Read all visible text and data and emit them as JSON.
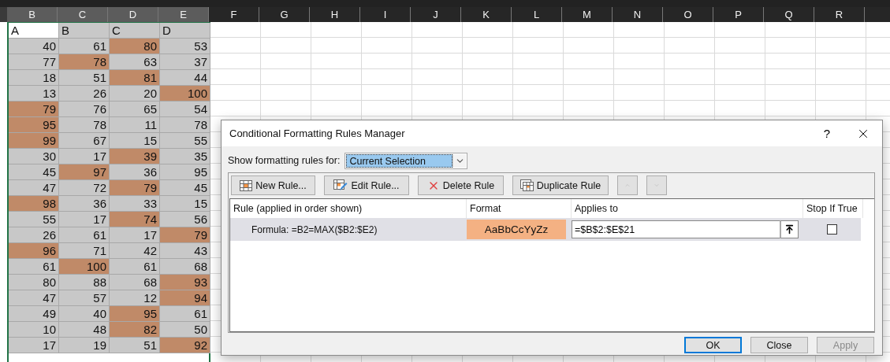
{
  "sheet": {
    "column_headers": [
      {
        "label": "B",
        "selected": true
      },
      {
        "label": "C",
        "selected": true
      },
      {
        "label": "D",
        "selected": true
      },
      {
        "label": "E",
        "selected": true
      },
      {
        "label": "F",
        "selected": false
      },
      {
        "label": "G",
        "selected": false
      },
      {
        "label": "H",
        "selected": false
      },
      {
        "label": "I",
        "selected": false
      },
      {
        "label": "J",
        "selected": false
      },
      {
        "label": "K",
        "selected": false
      },
      {
        "label": "L",
        "selected": false
      },
      {
        "label": "M",
        "selected": false
      },
      {
        "label": "N",
        "selected": false
      },
      {
        "label": "O",
        "selected": false
      },
      {
        "label": "P",
        "selected": false
      },
      {
        "label": "Q",
        "selected": false
      },
      {
        "label": "R",
        "selected": false
      }
    ],
    "header_row": [
      {
        "text": "A",
        "active": true
      },
      {
        "text": "B",
        "active": false
      },
      {
        "text": "C",
        "active": false
      },
      {
        "text": "D",
        "active": false
      }
    ],
    "rows": [
      [
        {
          "text": "40",
          "highlighted": false
        },
        {
          "text": "61",
          "highlighted": false
        },
        {
          "text": "80",
          "highlighted": true
        },
        {
          "text": "53",
          "highlighted": false
        }
      ],
      [
        {
          "text": "77",
          "highlighted": false
        },
        {
          "text": "78",
          "highlighted": true
        },
        {
          "text": "63",
          "highlighted": false
        },
        {
          "text": "37",
          "highlighted": false
        }
      ],
      [
        {
          "text": "18",
          "highlighted": false
        },
        {
          "text": "51",
          "highlighted": false
        },
        {
          "text": "81",
          "highlighted": true
        },
        {
          "text": "44",
          "highlighted": false
        }
      ],
      [
        {
          "text": "13",
          "highlighted": false
        },
        {
          "text": "26",
          "highlighted": false
        },
        {
          "text": "20",
          "highlighted": false
        },
        {
          "text": "100",
          "highlighted": true
        }
      ],
      [
        {
          "text": "79",
          "highlighted": true
        },
        {
          "text": "76",
          "highlighted": false
        },
        {
          "text": "65",
          "highlighted": false
        },
        {
          "text": "54",
          "highlighted": false
        }
      ],
      [
        {
          "text": "95",
          "highlighted": true
        },
        {
          "text": "78",
          "highlighted": false
        },
        {
          "text": "11",
          "highlighted": false
        },
        {
          "text": "78",
          "highlighted": false
        }
      ],
      [
        {
          "text": "99",
          "highlighted": true
        },
        {
          "text": "67",
          "highlighted": false
        },
        {
          "text": "15",
          "highlighted": false
        },
        {
          "text": "55",
          "highlighted": false
        }
      ],
      [
        {
          "text": "30",
          "highlighted": false
        },
        {
          "text": "17",
          "highlighted": false
        },
        {
          "text": "39",
          "highlighted": true
        },
        {
          "text": "35",
          "highlighted": false
        }
      ],
      [
        {
          "text": "45",
          "highlighted": false
        },
        {
          "text": "97",
          "highlighted": true
        },
        {
          "text": "36",
          "highlighted": false
        },
        {
          "text": "95",
          "highlighted": false
        }
      ],
      [
        {
          "text": "47",
          "highlighted": false
        },
        {
          "text": "72",
          "highlighted": false
        },
        {
          "text": "79",
          "highlighted": true
        },
        {
          "text": "45",
          "highlighted": false
        }
      ],
      [
        {
          "text": "98",
          "highlighted": true
        },
        {
          "text": "36",
          "highlighted": false
        },
        {
          "text": "33",
          "highlighted": false
        },
        {
          "text": "15",
          "highlighted": false
        }
      ],
      [
        {
          "text": "55",
          "highlighted": false
        },
        {
          "text": "17",
          "highlighted": false
        },
        {
          "text": "74",
          "highlighted": true
        },
        {
          "text": "56",
          "highlighted": false
        }
      ],
      [
        {
          "text": "26",
          "highlighted": false
        },
        {
          "text": "61",
          "highlighted": false
        },
        {
          "text": "17",
          "highlighted": false
        },
        {
          "text": "79",
          "highlighted": true
        }
      ],
      [
        {
          "text": "96",
          "highlighted": true
        },
        {
          "text": "71",
          "highlighted": false
        },
        {
          "text": "42",
          "highlighted": false
        },
        {
          "text": "43",
          "highlighted": false
        }
      ],
      [
        {
          "text": "61",
          "highlighted": false
        },
        {
          "text": "100",
          "highlighted": true
        },
        {
          "text": "61",
          "highlighted": false
        },
        {
          "text": "68",
          "highlighted": false
        }
      ],
      [
        {
          "text": "80",
          "highlighted": false
        },
        {
          "text": "88",
          "highlighted": false
        },
        {
          "text": "68",
          "highlighted": false
        },
        {
          "text": "93",
          "highlighted": true
        }
      ],
      [
        {
          "text": "47",
          "highlighted": false
        },
        {
          "text": "57",
          "highlighted": false
        },
        {
          "text": "12",
          "highlighted": false
        },
        {
          "text": "94",
          "highlighted": true
        }
      ],
      [
        {
          "text": "49",
          "highlighted": false
        },
        {
          "text": "40",
          "highlighted": false
        },
        {
          "text": "95",
          "highlighted": true
        },
        {
          "text": "61",
          "highlighted": false
        }
      ],
      [
        {
          "text": "10",
          "highlighted": false
        },
        {
          "text": "48",
          "highlighted": false
        },
        {
          "text": "82",
          "highlighted": true
        },
        {
          "text": "50",
          "highlighted": false
        }
      ],
      [
        {
          "text": "17",
          "highlighted": false
        },
        {
          "text": "19",
          "highlighted": false
        },
        {
          "text": "51",
          "highlighted": false
        },
        {
          "text": "92",
          "highlighted": true
        }
      ]
    ]
  },
  "dialog": {
    "title": "Conditional Formatting Rules Manager",
    "help_button": "?",
    "show_rules_for": {
      "label": "Show formatting rules for:",
      "value": "Current Selection"
    },
    "toolbar": [
      {
        "kind": "new",
        "label": "New Rule...",
        "disabled": false
      },
      {
        "kind": "edit",
        "label": "Edit Rule...",
        "disabled": false
      },
      {
        "kind": "delete",
        "label": "Delete Rule",
        "disabled": false
      },
      {
        "kind": "duplicate",
        "label": "Duplicate Rule",
        "disabled": false
      },
      {
        "kind": "up",
        "disabled": true
      },
      {
        "kind": "down",
        "disabled": true
      }
    ],
    "columns": [
      "Rule (applied in order shown)",
      "Format",
      "Applies to",
      "Stop If True"
    ],
    "rules": [
      {
        "rule": "Formula: =B2=MAX($B2:$E2)",
        "format_preview": "AaBbCcYyZz",
        "applies_to": "=$B$2:$E$21",
        "stop_if_true": false,
        "selected": true
      }
    ],
    "buttons": [
      {
        "label": "OK",
        "default": true,
        "disabled": false
      },
      {
        "label": "Close",
        "default": false,
        "disabled": false
      },
      {
        "label": "Apply",
        "default": false,
        "disabled": true
      }
    ]
  }
}
